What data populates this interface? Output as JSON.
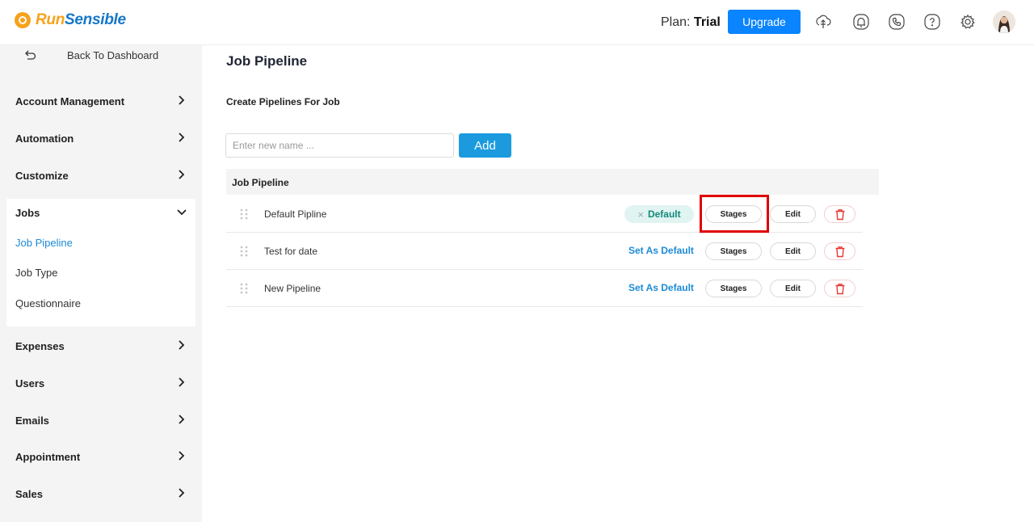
{
  "brand": {
    "name_part1": "Run",
    "name_part2": "Sensible"
  },
  "header": {
    "plan_label": "Plan:",
    "plan_value": "Trial",
    "upgrade_label": "Upgrade",
    "icons": [
      "upload-cloud-icon",
      "bell-icon",
      "phone-icon",
      "help-icon",
      "gear-icon",
      "avatar"
    ]
  },
  "sidebar": {
    "back_label": "Back To Dashboard",
    "items": [
      {
        "label": "Account Management",
        "expanded": false
      },
      {
        "label": "Automation",
        "expanded": false
      },
      {
        "label": "Customize",
        "expanded": false
      },
      {
        "label": "Jobs",
        "expanded": true
      },
      {
        "label": "Expenses",
        "expanded": false
      },
      {
        "label": "Users",
        "expanded": false
      },
      {
        "label": "Emails",
        "expanded": false
      },
      {
        "label": "Appointment",
        "expanded": false
      },
      {
        "label": "Sales",
        "expanded": false
      }
    ],
    "jobs_subitems": [
      {
        "label": "Job Pipeline",
        "active": true
      },
      {
        "label": "Job Type",
        "active": false
      },
      {
        "label": "Questionnaire",
        "active": false
      }
    ]
  },
  "main": {
    "page_title": "Job Pipeline",
    "section_title": "Create Pipelines For Job",
    "new_name_placeholder": "Enter new name ...",
    "add_label": "Add",
    "table_header": "Job Pipeline",
    "rows": [
      {
        "name": "Default Pipline",
        "is_default": true,
        "default_label": "Default",
        "stages_label": "Stages",
        "edit_label": "Edit"
      },
      {
        "name": "Test for date",
        "is_default": false,
        "set_default_label": "Set As Default",
        "stages_label": "Stages",
        "edit_label": "Edit"
      },
      {
        "name": "New Pipeline",
        "is_default": false,
        "set_default_label": "Set As Default",
        "stages_label": "Stages",
        "edit_label": "Edit"
      }
    ]
  },
  "colors": {
    "accent_blue": "#1c8ad6",
    "upgrade_blue": "#0a84ff",
    "brand_orange": "#f6a21a",
    "default_green": "#128a7c",
    "delete_red": "#e53935",
    "highlight_red": "#e00000"
  }
}
